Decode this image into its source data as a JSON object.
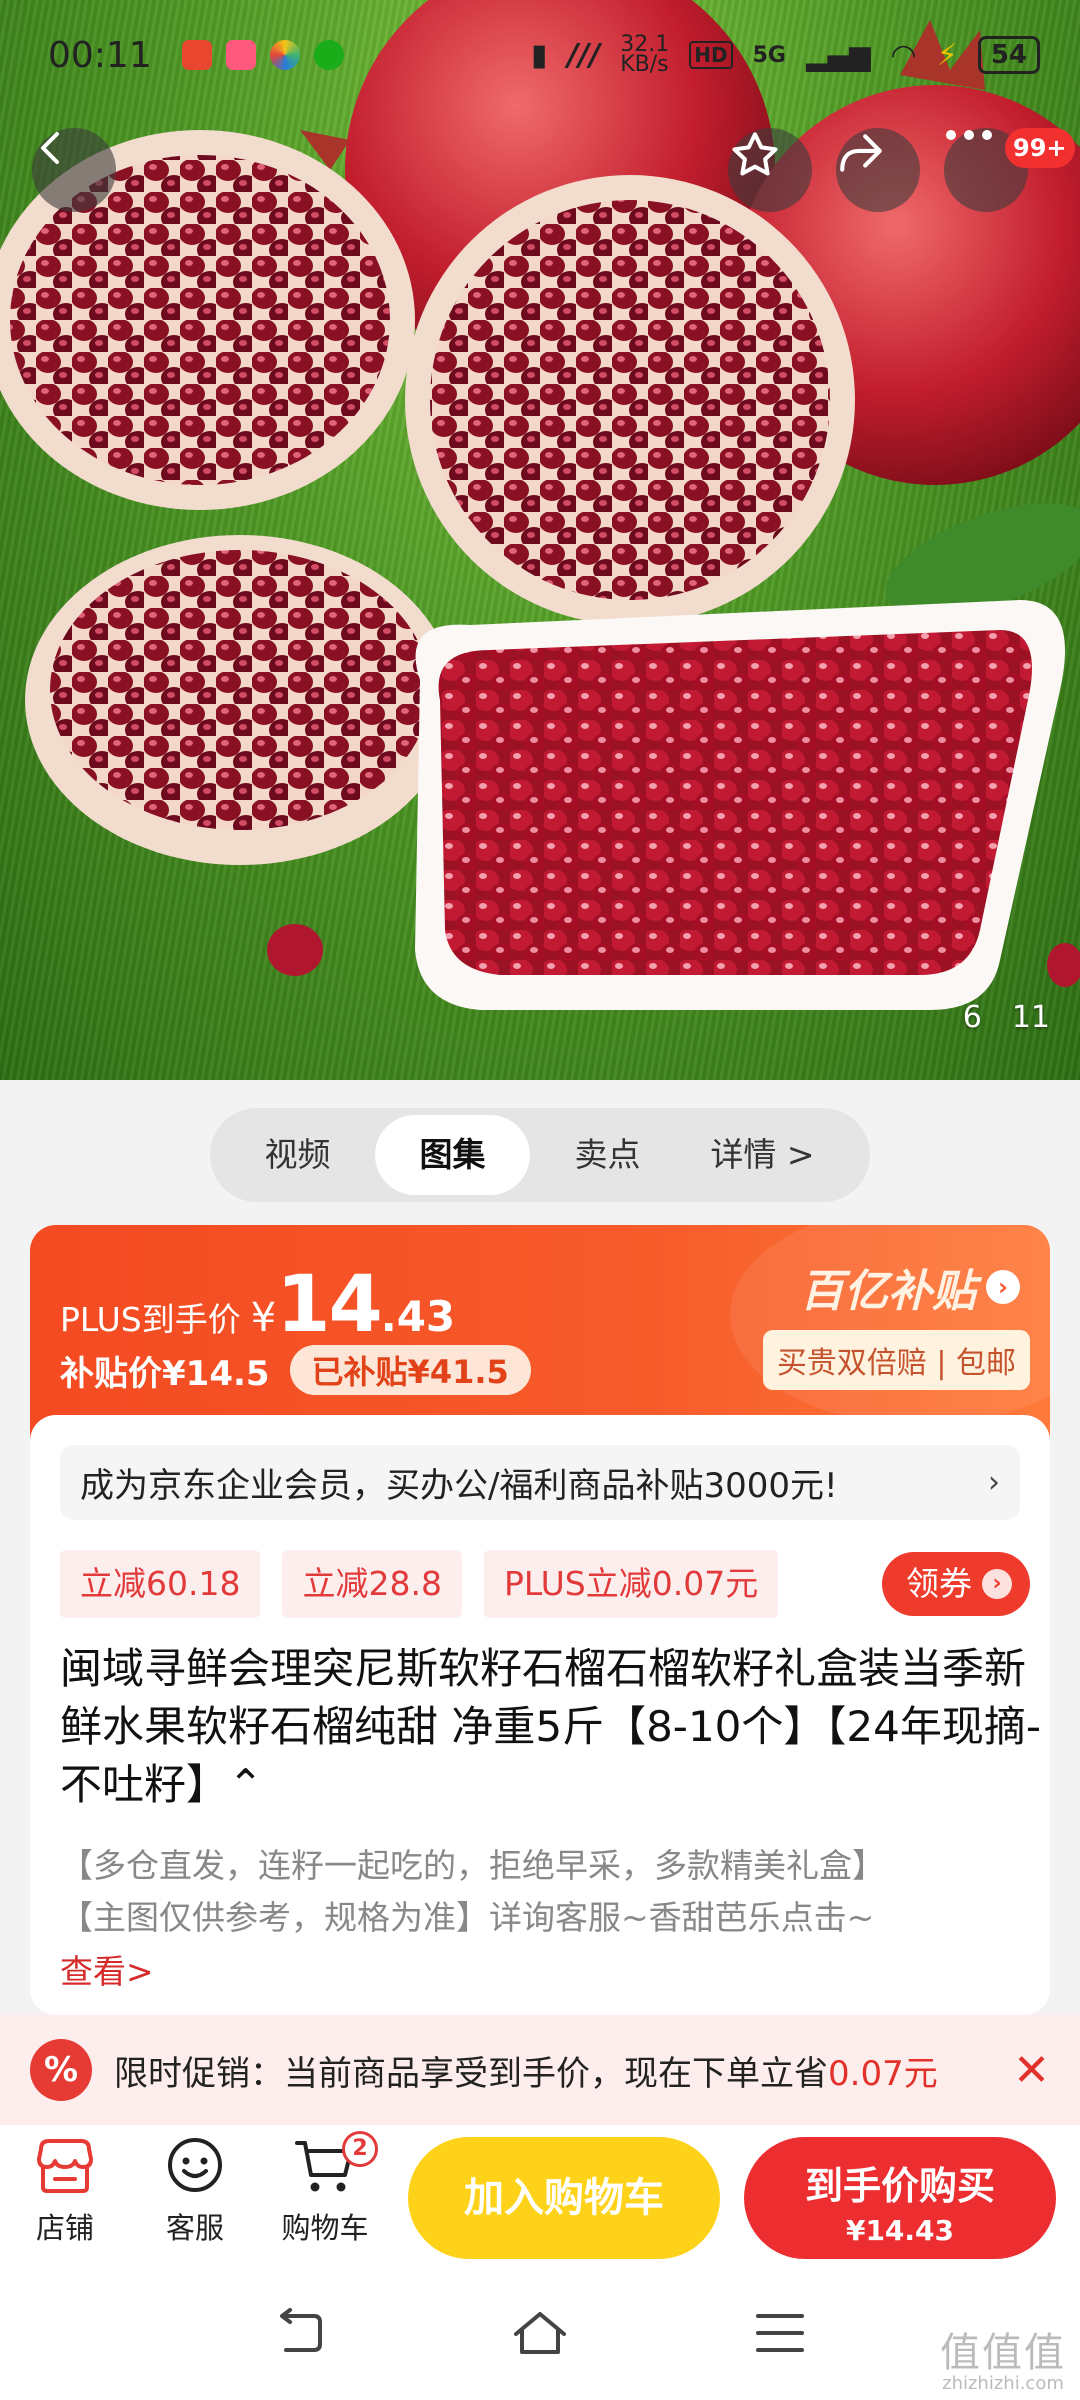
{
  "status_bar": {
    "time": "00:11",
    "speed": "32.1\nKB/s",
    "network": "5G",
    "battery": "54"
  },
  "header": {
    "notification_badge": "99+"
  },
  "gallery": {
    "current": "6",
    "total": "11"
  },
  "tabs": [
    {
      "label": "视频"
    },
    {
      "label": "图集"
    },
    {
      "label": "卖点"
    },
    {
      "label": "详情 >"
    }
  ],
  "price": {
    "plus_label": "PLUS到手价",
    "currency": "¥",
    "plus_integer": "14",
    "plus_decimal": ".43",
    "subsidy_label": "补贴价¥14.5",
    "subsidized_badge": "已补贴¥41.5",
    "brand": "百亿补贴",
    "brand_sub": "买贵双倍赔 | 包邮"
  },
  "enterprise_banner": {
    "text": "成为京东企业会员，买办公/福利商品补贴3000元!",
    "chevron": "›"
  },
  "coupons": [
    "立减60.18",
    "立减28.8",
    "PLUS立减0.07元"
  ],
  "coupon_button": {
    "label": "领券"
  },
  "product": {
    "title": "闽域寻鲜会理突尼斯软籽石榴石榴软籽礼盒装当季新鲜水果软籽石榴纯甜 净重5斤【8-10个】【24年现摘-不吐籽】⌃",
    "desc_line1": "【多仓直发，连籽一起吃的，拒绝早采，多款精美礼盒】",
    "desc_line2": "【主图仅供参考，规格为准】详询客服~香甜芭乐点击~",
    "more": "查看>"
  },
  "promo": {
    "icon": "%",
    "text": "限时促销：当前商品享受到手价，现在下单立省",
    "highlight": "0.07元",
    "close": "✕"
  },
  "action_bar": {
    "shop": "店铺",
    "service": "客服",
    "cart": "购物车",
    "cart_count": "2",
    "add_to_cart": "加入购物车",
    "buy_line1": "到手价购买",
    "buy_line2": "¥14.43"
  },
  "watermark": {
    "big": "值值值",
    "small": "zhizhizhi.com"
  },
  "colors": {
    "accent_red": "#ec2e31",
    "accent_orange": "#f44a22",
    "cart_yellow": "#ffd21a"
  }
}
